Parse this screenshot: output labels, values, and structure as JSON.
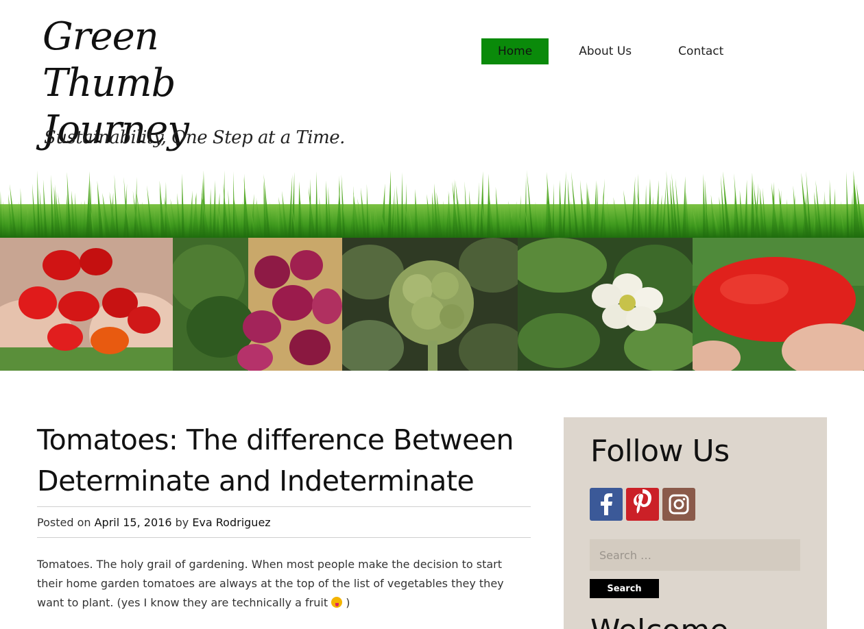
{
  "site": {
    "title": "Green Thumb Journey",
    "tagline": "Sustainability, One Step at a Time."
  },
  "nav": {
    "items": [
      {
        "label": "Home",
        "active": true
      },
      {
        "label": "About Us",
        "active": false
      },
      {
        "label": "Contact",
        "active": false
      }
    ],
    "active_color": "#0a8a0a"
  },
  "banner": {
    "photos": [
      "red-peppers-photo",
      "kale-beets-photo",
      "broccoli-photo",
      "white-flower-photo",
      "red-tomato-photo"
    ]
  },
  "post": {
    "title": "Tomatoes: The difference Between Determinate and Indeterminate",
    "posted_on_label": "Posted on",
    "date": "April 15, 2016",
    "by_label": "by",
    "author": "Eva Rodriguez",
    "body": "Tomatoes. The holy grail of gardening. When most people make the decision to start their home garden tomatoes are always at the top of the list of vegetables they they want to plant. (yes I know they are technically a fruit",
    "body_end": ")"
  },
  "sidebar": {
    "follow_title": "Follow Us",
    "social": [
      {
        "name": "facebook-icon",
        "glyph": "f",
        "color": "#3b5998"
      },
      {
        "name": "pinterest-icon",
        "glyph": "P",
        "color": "#cb2027"
      },
      {
        "name": "instagram-icon",
        "glyph": "◎",
        "color": "#8a5a4a"
      }
    ],
    "search_placeholder": "Search …",
    "search_button": "Search",
    "welcome_title": "Welcome"
  },
  "colors": {
    "sidebar_bg": "#ddd6cd",
    "grass": "#3f9a1e"
  }
}
